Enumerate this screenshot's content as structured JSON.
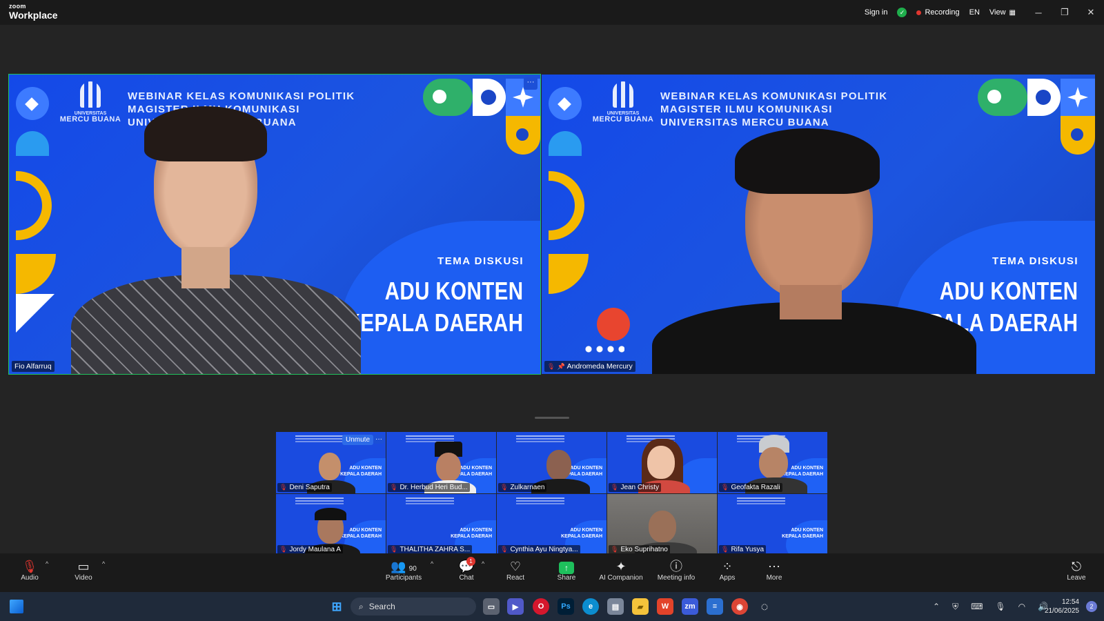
{
  "app": {
    "logo_top": "zoom",
    "logo_bottom": "Workplace"
  },
  "titlebar": {
    "sign_in": "Sign in",
    "recording": "Recording",
    "language": "EN",
    "view": "View"
  },
  "slide": {
    "title_lines": [
      "WEBINAR KELAS KOMUNIKASI POLITIK",
      "MAGISTER ILMU KOMUNIKASI",
      "UNIVERSITAS MERCU BUANA"
    ],
    "uni_small": "UNIVERSITAS",
    "uni_big": "MERCU BUANA",
    "tema_label": "TEMA DISKUSI",
    "tema_line1": "ADU KONTEN",
    "tema_line2": "KEPALA DAERAH"
  },
  "speakers": [
    {
      "name": "Fio Alfarruq",
      "active": true
    },
    {
      "name": "Andromeda Mercury",
      "pinned": true,
      "muted": true
    }
  ],
  "gallery": [
    {
      "name": "Deni Saputra",
      "muted": true
    },
    {
      "name": "Dr. Herbud Heri Bud...",
      "muted": true
    },
    {
      "name": "Zulkarnaen",
      "muted": true
    },
    {
      "name": "Jean Christy",
      "muted": true
    },
    {
      "name": "Geofakta Razali",
      "muted": true
    },
    {
      "name": "Jordy Maulana A",
      "muted": true
    },
    {
      "name": "THALITHA ZAHRA S...",
      "muted": true
    },
    {
      "name": "Cynthia Ayu Ningtya...",
      "muted": true
    },
    {
      "name": "Eko Suprihatno",
      "muted": true
    },
    {
      "name": "Rifa Yusya",
      "muted": true
    }
  ],
  "gallery_controls": {
    "unmute": "Unmute",
    "more": "···"
  },
  "toolbar": {
    "audio": "Audio",
    "video": "Video",
    "participants": "Participants",
    "participants_count": "90",
    "chat": "Chat",
    "chat_badge": "1",
    "react": "React",
    "share": "Share",
    "ai_companion": "AI Companion",
    "meeting_info": "Meeting info",
    "apps": "Apps",
    "more": "More",
    "leave": "Leave"
  },
  "taskbar": {
    "search": "Search",
    "time": "12:54",
    "date": "21/06/2025",
    "notifications": "2"
  },
  "colors": {
    "active_speaker_border": "#22c35d",
    "slide_blue": "#1449e8",
    "recording_dot": "#e0362f",
    "share_green": "#1ebf5c"
  }
}
